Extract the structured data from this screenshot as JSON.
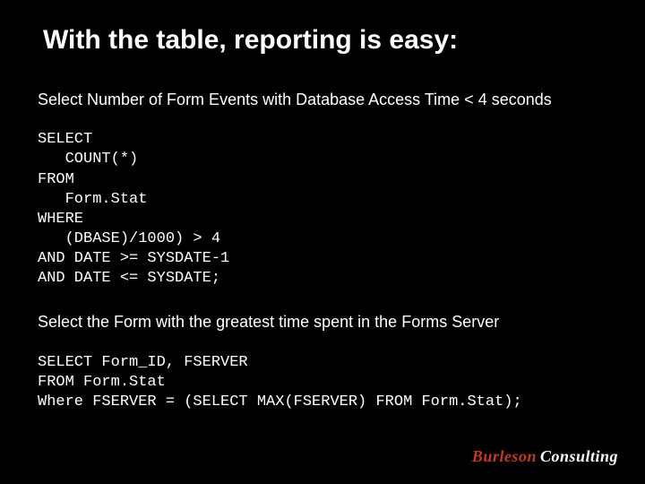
{
  "title": "With the table, reporting is easy:",
  "subtitle1": "Select Number of Form Events with Database Access Time < 4 seconds",
  "code1": "SELECT\n   COUNT(*)\nFROM\n   Form.Stat\nWHERE\n   (DBASE)/1000) > 4\nAND DATE >= SYSDATE-1\nAND DATE <= SYSDATE;",
  "subtitle2": "Select the Form with the greatest time spent in the Forms Server",
  "code2": "SELECT Form_ID, FSERVER\nFROM Form.Stat\nWhere FSERVER = (SELECT MAX(FSERVER) FROM Form.Stat);",
  "brand1": "Burleson",
  "brand2": "Consulting"
}
